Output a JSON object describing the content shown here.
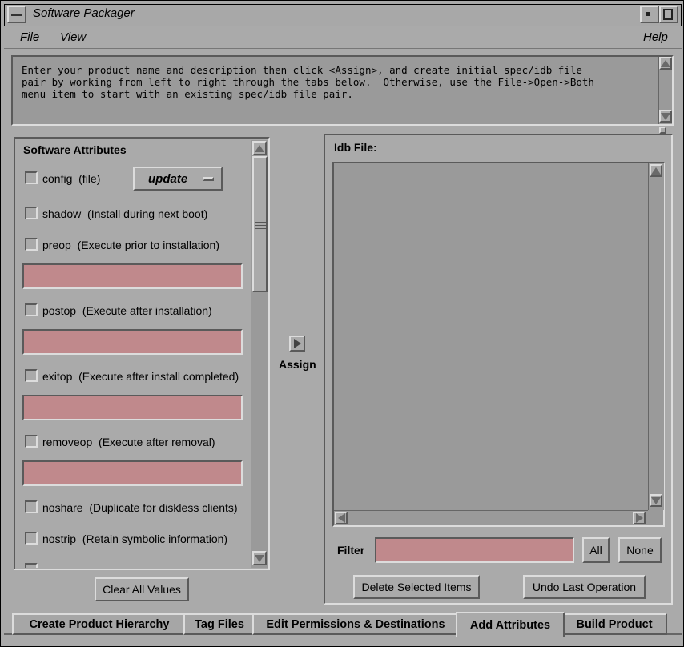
{
  "window": {
    "title": "Software Packager"
  },
  "menu": {
    "file": "File",
    "view": "View",
    "help": "Help"
  },
  "instructions": "Enter your product name and description then click <Assign>, and create initial spec/idb file\npair by working from left to right through the tabs below.  Otherwise, use the File->Open->Both\nmenu item to start with an existing spec/idb file pair.",
  "attributes": {
    "heading": "Software Attributes",
    "config": {
      "name": "config",
      "desc": "(file)",
      "option_value": "update"
    },
    "shadow": {
      "name": "shadow",
      "desc": "(Install during next boot)"
    },
    "preop": {
      "name": "preop",
      "desc": "(Execute prior to installation)",
      "value": ""
    },
    "postop": {
      "name": "postop",
      "desc": "(Execute after installation)",
      "value": ""
    },
    "exitop": {
      "name": "exitop",
      "desc": "(Execute after install completed)",
      "value": ""
    },
    "removeop": {
      "name": "removeop",
      "desc": "(Execute after removal)",
      "value": ""
    },
    "noshare": {
      "name": "noshare",
      "desc": "(Duplicate for diskless clients)"
    },
    "nostrip": {
      "name": "nostrip",
      "desc": "(Retain symbolic information)"
    },
    "clear_button": "Clear All Values"
  },
  "assign": {
    "label": "Assign"
  },
  "idb": {
    "heading": "Idb File:",
    "filter_label": "Filter",
    "filter_value": "",
    "all_button": "All",
    "none_button": "None",
    "delete_button": "Delete Selected Items",
    "undo_button": "Undo Last Operation"
  },
  "tabs": [
    {
      "label": "Create Product Hierarchy"
    },
    {
      "label": "Tag Files"
    },
    {
      "label": "Edit Permissions & Destinations"
    },
    {
      "label": "Add Attributes"
    },
    {
      "label": "Build Product"
    }
  ],
  "active_tab": "Add Attributes",
  "colors": {
    "background": "#aaaaaa",
    "field": "#c0898c",
    "list": "#9a9a9a"
  }
}
